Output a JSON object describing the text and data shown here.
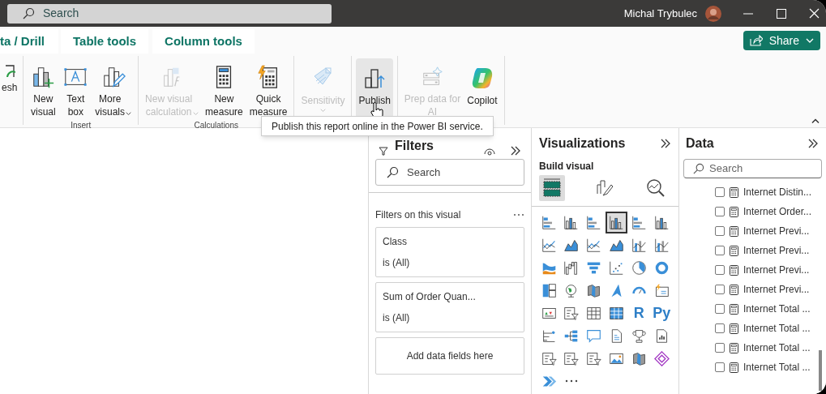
{
  "title_bar": {
    "search_placeholder": "Search",
    "user_name": "Michal Trybulec"
  },
  "ribbon_tabs": [
    {
      "label": "ta / Drill"
    },
    {
      "label": "Table tools"
    },
    {
      "label": "Column tools"
    }
  ],
  "share_button": {
    "label": "Share"
  },
  "ribbon_groups": [
    {
      "buttons": [
        {
          "kind": "refresh",
          "label_lines": [
            "esh"
          ],
          "disabled": false,
          "hovered": false,
          "dropdown": false
        }
      ]
    },
    {
      "label": "Insert",
      "buttons": [
        {
          "kind": "new-visual",
          "label_lines": [
            "New",
            "visual"
          ],
          "disabled": false,
          "hovered": false,
          "dropdown": false
        },
        {
          "kind": "text-box",
          "label_lines": [
            "Text",
            "box"
          ],
          "disabled": false,
          "hovered": false,
          "dropdown": false
        },
        {
          "kind": "more-visuals",
          "label_lines": [
            "More",
            "visuals"
          ],
          "disabled": false,
          "hovered": false,
          "dropdown": true
        }
      ]
    },
    {
      "label": "Calculations",
      "buttons": [
        {
          "kind": "visual-calc",
          "label_lines": [
            "New visual",
            "calculation"
          ],
          "disabled": true,
          "hovered": false,
          "dropdown": true
        },
        {
          "kind": "measure",
          "label_lines": [
            "New",
            "measure"
          ],
          "disabled": false,
          "hovered": false,
          "dropdown": false
        },
        {
          "kind": "quick-measure",
          "label_lines": [
            "Quick",
            "measure"
          ],
          "disabled": false,
          "hovered": false,
          "dropdown": false
        }
      ]
    },
    {
      "buttons": [
        {
          "kind": "sensitivity",
          "label_lines": [
            "Sensitivity"
          ],
          "disabled": true,
          "hovered": false,
          "dropdown": true
        }
      ]
    },
    {
      "buttons": [
        {
          "kind": "publish",
          "label_lines": [
            "Publish"
          ],
          "disabled": false,
          "hovered": true,
          "dropdown": false
        }
      ]
    },
    {
      "buttons": [
        {
          "kind": "prep-ai",
          "label_lines": [
            "Prep data for",
            "AI"
          ],
          "disabled": true,
          "hovered": false,
          "dropdown": false
        },
        {
          "kind": "copilot",
          "label_lines": [
            "Copilot"
          ],
          "disabled": false,
          "hovered": false,
          "dropdown": false
        }
      ]
    }
  ],
  "tooltip": "Publish this report online in the Power BI service.",
  "filters": {
    "title": "Filters",
    "search_placeholder": "Search",
    "section": "Filters on this visual",
    "cards": [
      {
        "field": "Class",
        "condition": "is (All)"
      },
      {
        "field": "Sum of Order Quan...",
        "condition": "is (All)"
      }
    ],
    "add_fields": "Add data fields here"
  },
  "visualizations": {
    "title": "Visualizations",
    "subtitle": "Build visual",
    "tabs": [
      {
        "kind": "fields",
        "selected": true
      },
      {
        "kind": "format",
        "selected": false
      },
      {
        "kind": "analytics",
        "selected": false
      }
    ],
    "visuals": [
      {
        "kind": "hbar",
        "selected": false
      },
      {
        "kind": "column",
        "selected": false
      },
      {
        "kind": "hbar",
        "selected": false
      },
      {
        "kind": "column",
        "selected": true
      },
      {
        "kind": "hbar",
        "selected": false
      },
      {
        "kind": "column",
        "selected": false
      },
      {
        "kind": "line",
        "selected": false
      },
      {
        "kind": "area",
        "selected": false
      },
      {
        "kind": "line",
        "selected": false
      },
      {
        "kind": "area",
        "selected": false
      },
      {
        "kind": "combo",
        "selected": false
      },
      {
        "kind": "combo",
        "selected": false
      },
      {
        "kind": "ribbon",
        "selected": false
      },
      {
        "kind": "waterfall",
        "selected": false
      },
      {
        "kind": "funnel",
        "selected": false
      },
      {
        "kind": "scatter",
        "selected": false
      },
      {
        "kind": "pie",
        "selected": false
      },
      {
        "kind": "donut",
        "selected": false
      },
      {
        "kind": "treemap",
        "selected": false
      },
      {
        "kind": "globe",
        "selected": false
      },
      {
        "kind": "map",
        "selected": false
      },
      {
        "kind": "arrow",
        "selected": false
      },
      {
        "kind": "gauge",
        "selected": false
      },
      {
        "kind": "card",
        "selected": false
      },
      {
        "kind": "kpi",
        "selected": false
      },
      {
        "kind": "slicer",
        "selected": false
      },
      {
        "kind": "table",
        "selected": false
      },
      {
        "kind": "matrix",
        "selected": false
      },
      {
        "kind": "letter",
        "label": "R",
        "selected": false
      },
      {
        "kind": "letter",
        "label": "Py",
        "selected": false
      },
      {
        "kind": "influencers",
        "selected": false
      },
      {
        "kind": "tree",
        "selected": false
      },
      {
        "kind": "bubble",
        "selected": false
      },
      {
        "kind": "document",
        "selected": false
      },
      {
        "kind": "trophy",
        "selected": false
      },
      {
        "kind": "report",
        "selected": false
      },
      {
        "kind": "slicer",
        "selected": false
      },
      {
        "kind": "slicer",
        "selected": false
      },
      {
        "kind": "slicer",
        "selected": false
      },
      {
        "kind": "image",
        "selected": false
      },
      {
        "kind": "map",
        "selected": false
      },
      {
        "kind": "diamond",
        "selected": false
      },
      {
        "kind": "chevrons",
        "selected": false
      },
      {
        "kind": "more",
        "selected": false
      }
    ]
  },
  "data": {
    "title": "Data",
    "search_placeholder": "Search",
    "fields": [
      {
        "name": "Internet Distin...",
        "checked": false
      },
      {
        "name": "Internet Order...",
        "checked": false
      },
      {
        "name": "Internet Previ...",
        "checked": false
      },
      {
        "name": "Internet Previ...",
        "checked": false
      },
      {
        "name": "Internet Previ...",
        "checked": false
      },
      {
        "name": "Internet Previ...",
        "checked": false
      },
      {
        "name": "Internet Total ...",
        "checked": false
      },
      {
        "name": "Internet Total ...",
        "checked": false
      },
      {
        "name": "Internet Total ...",
        "checked": false
      },
      {
        "name": "Internet Total ...",
        "checked": false
      }
    ]
  }
}
